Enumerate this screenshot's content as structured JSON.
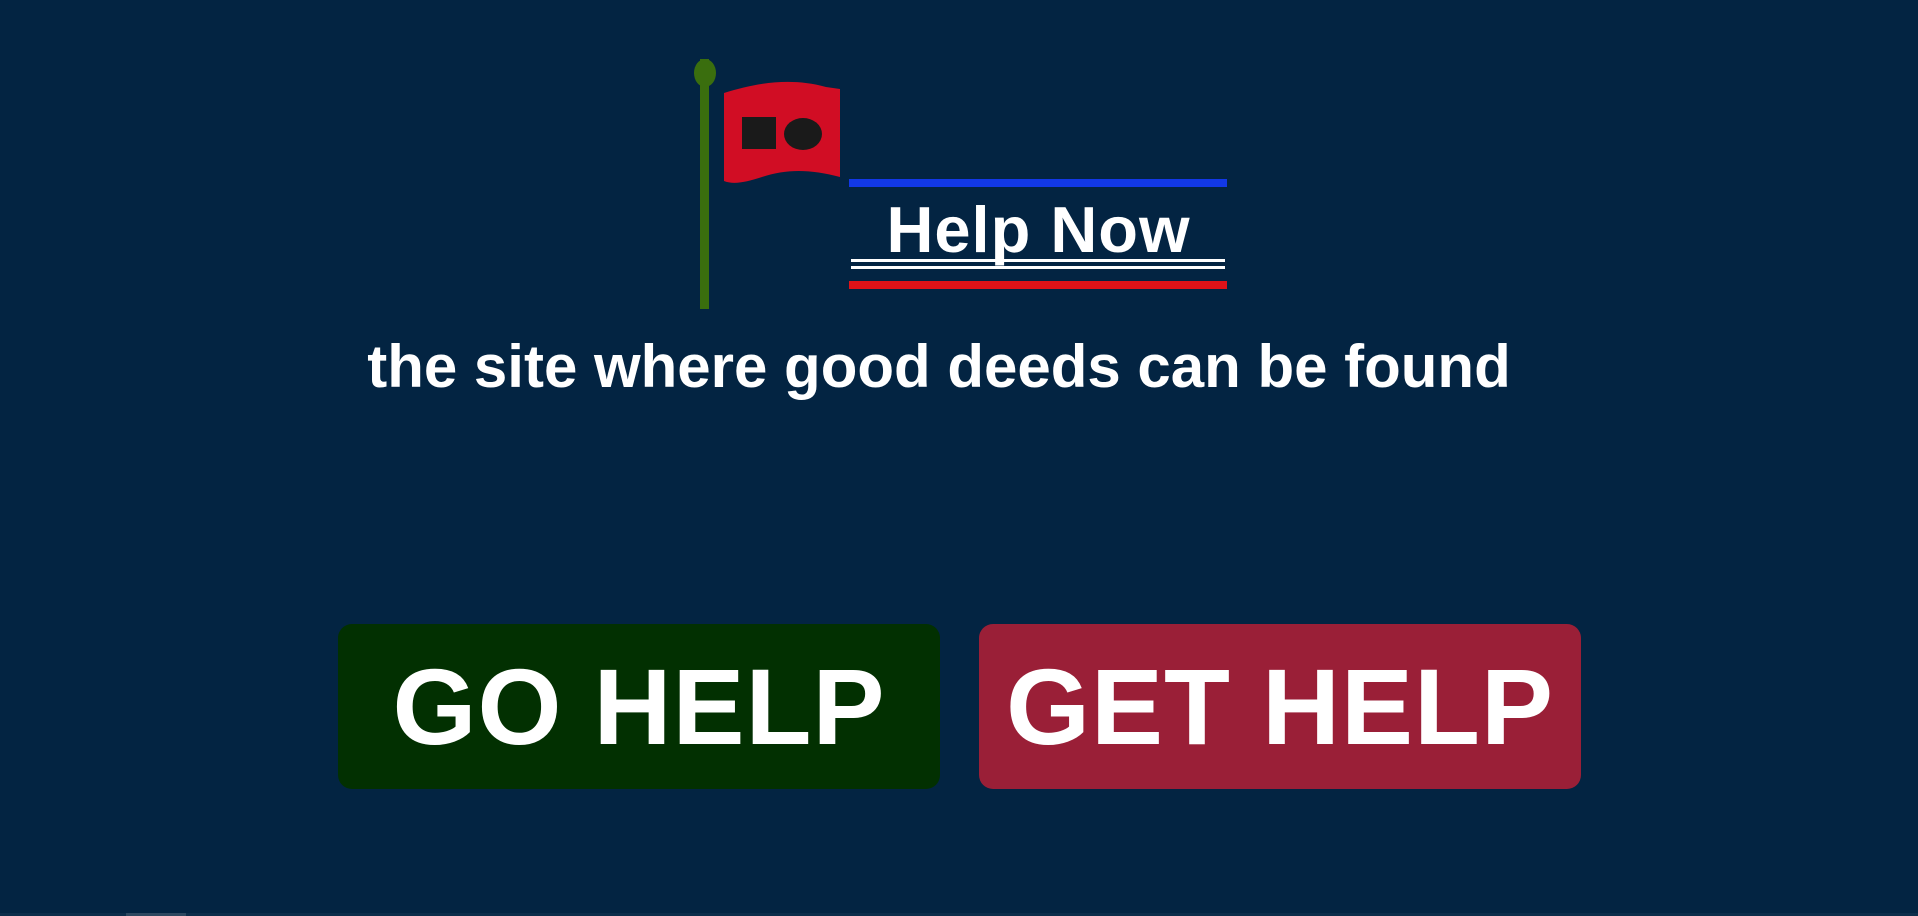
{
  "logo": {
    "wordmark": "Help Now",
    "colors": {
      "pole": "#3a6e0e",
      "flag": "#d10d24",
      "flag_shapes": "#1a1a1a",
      "top_rule": "#1238e6",
      "bottom_rule": "#e01218",
      "wordmark": "#ffffff"
    },
    "icons": [
      "flag-icon",
      "square-icon",
      "circle-icon"
    ]
  },
  "tagline": "the site where good deeds can be found",
  "buttons": {
    "go_help": {
      "label": "GO HELP",
      "color": "#023001"
    },
    "get_help": {
      "label": "GET HELP",
      "color": "#9a1f37"
    }
  },
  "theme": {
    "background": "#032442",
    "text": "#ffffff"
  }
}
